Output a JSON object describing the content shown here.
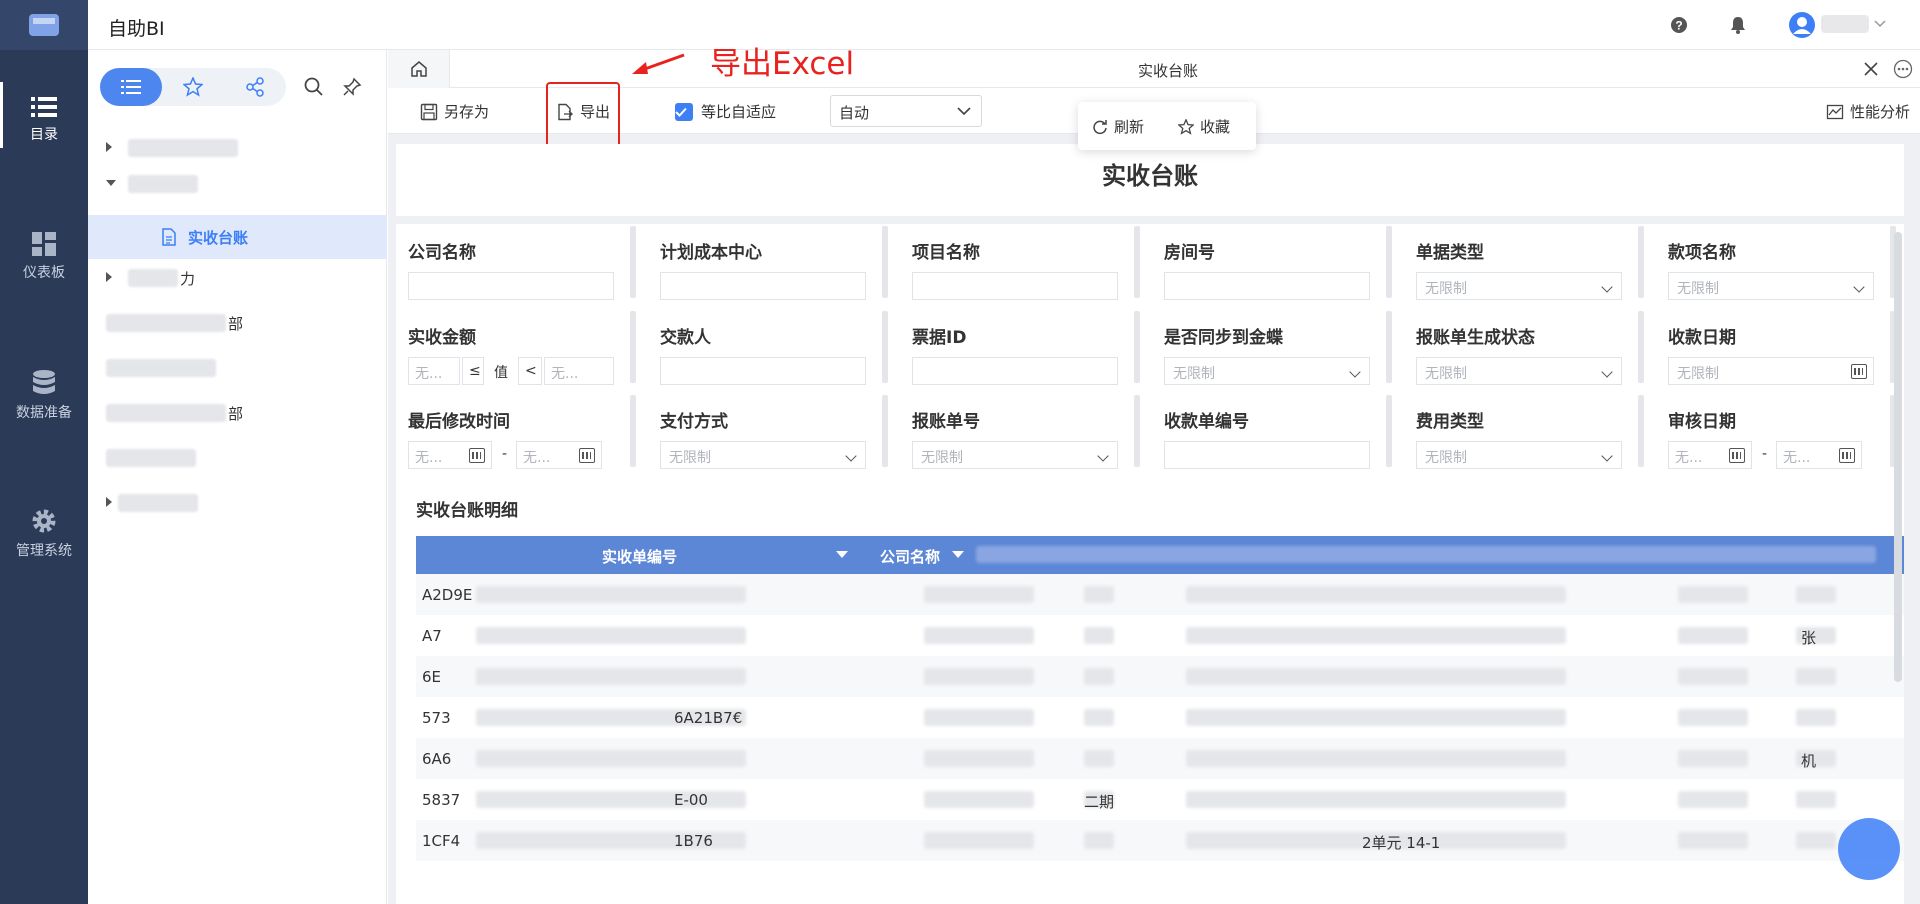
{
  "app": {
    "title": "自助BI"
  },
  "rail": {
    "items": [
      {
        "label": "目录",
        "icon": "catalog-list-icon"
      },
      {
        "label": "仪表板",
        "icon": "dashboard-icon"
      },
      {
        "label": "数据准备",
        "icon": "database-icon"
      },
      {
        "label": "管理系统",
        "icon": "gear-icon"
      }
    ]
  },
  "catalog": {
    "selected_item": "实收台账",
    "partial_labels": {
      "r4": "力",
      "r5": "部",
      "r7": "部"
    }
  },
  "tab": {
    "title": "实收台账"
  },
  "toolbar": {
    "save_as": "另存为",
    "export": "导出",
    "fit_label": "等比自适应",
    "zoom_value": "自动",
    "refresh": "刷新",
    "favorite": "收藏",
    "perf": "性能分析"
  },
  "annotation": {
    "text": "导出Excel",
    "color": "#e8231f"
  },
  "report": {
    "title": "实收台账",
    "filters": [
      {
        "label": "公司名称",
        "type": "text"
      },
      {
        "label": "计划成本中心",
        "type": "text"
      },
      {
        "label": "项目名称",
        "type": "text"
      },
      {
        "label": "房间号",
        "type": "text"
      },
      {
        "label": "单据类型",
        "type": "select",
        "placeholder": "无限制"
      },
      {
        "label": "款项名称",
        "type": "select",
        "placeholder": "无限制"
      },
      {
        "label": "实收金额",
        "type": "range",
        "ph_left": "无...",
        "op_left": "≤",
        "mid": "值",
        "op_right": "<",
        "ph_right": "无..."
      },
      {
        "label": "交款人",
        "type": "text"
      },
      {
        "label": "票据ID",
        "type": "text"
      },
      {
        "label": "是否同步到金蝶",
        "type": "select",
        "placeholder": "无限制"
      },
      {
        "label": "报账单生成状态",
        "type": "select",
        "placeholder": "无限制"
      },
      {
        "label": "收款日期",
        "type": "date",
        "placeholder": "无限制"
      },
      {
        "label": "最后修改时间",
        "type": "daterange",
        "ph_left": "无...",
        "dash": "-",
        "ph_right": "无..."
      },
      {
        "label": "支付方式",
        "type": "select",
        "placeholder": "无限制"
      },
      {
        "label": "报账单号",
        "type": "select",
        "placeholder": "无限制"
      },
      {
        "label": "收款单编号",
        "type": "text"
      },
      {
        "label": "费用类型",
        "type": "select",
        "placeholder": "无限制"
      },
      {
        "label": "审核日期",
        "type": "daterange",
        "ph_left": "无...",
        "dash": "-",
        "ph_right": "无..."
      }
    ],
    "detail_title": "实收台账明细",
    "columns": [
      "实收单编号",
      "公司名称"
    ],
    "rows": [
      {
        "id": "A2D9E",
        "c3": "",
        "c4": "",
        "tail": ""
      },
      {
        "id": "A7",
        "c3": "",
        "c4": "",
        "tail": "张"
      },
      {
        "id": "6E",
        "c3": "",
        "c4": "",
        "tail": ""
      },
      {
        "id": "573",
        "mid": "6A21B7€",
        "c3": "",
        "c4": "",
        "tail": ""
      },
      {
        "id": "6A6",
        "c3": "",
        "c4": "",
        "tail": "机"
      },
      {
        "id": "5837",
        "mid": "E-00",
        "c3": "二期",
        "c4": "",
        "tail": ""
      },
      {
        "id": "1CF4",
        "mid": "1B76",
        "c3": "",
        "c4": "2单元 14-1",
        "tail": ""
      }
    ]
  }
}
